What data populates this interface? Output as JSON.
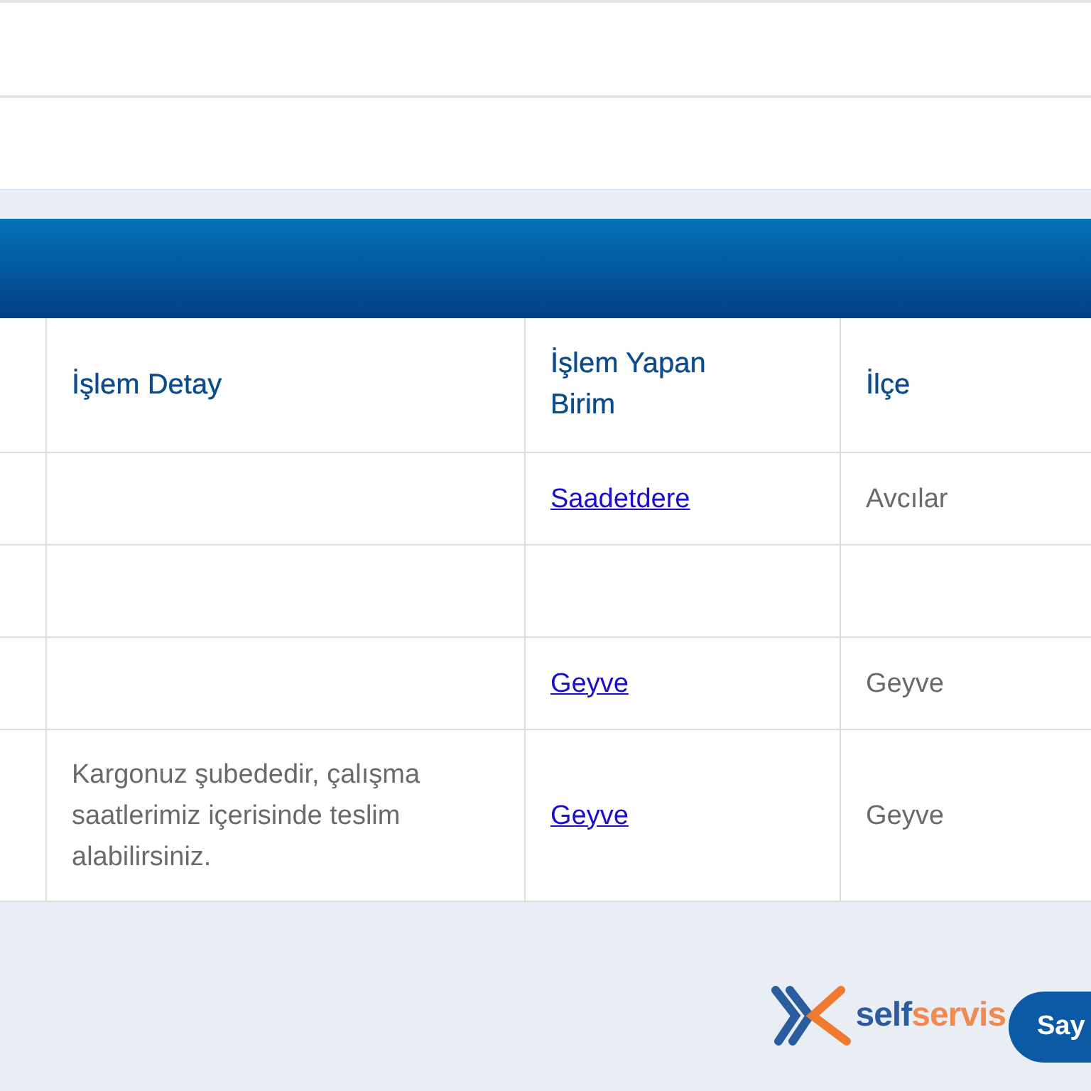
{
  "table": {
    "columns": [
      {
        "label": "İşlem Detay"
      },
      {
        "label": "İşlem Yapan Birim"
      },
      {
        "label": "İlçe"
      }
    ],
    "rows": [
      {
        "unit": "Saadetdere",
        "district": "Avcılar"
      },
      {},
      {
        "unit": "Geyve",
        "district": "Geyve"
      },
      {
        "detail": "Kargonuz şubededir, çalışma saatlerimiz içerisinde teslim alabilirsiniz.",
        "unit": "Geyve",
        "district": "Geyve"
      }
    ]
  },
  "footer": {
    "logo": {
      "part_1": "self",
      "part_2": "servis"
    },
    "button": "Say"
  }
}
